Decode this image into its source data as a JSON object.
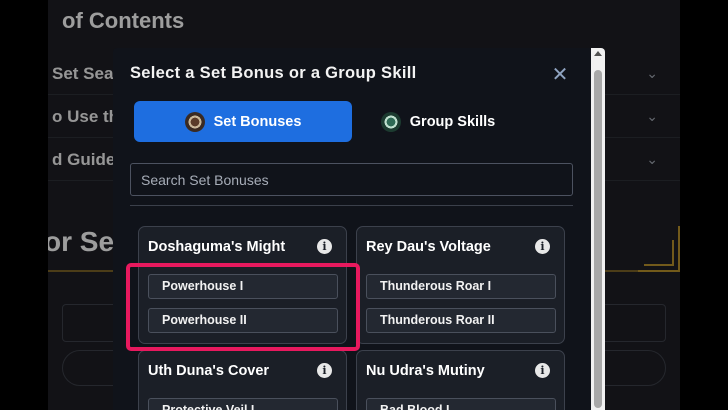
{
  "background": {
    "heading_top": "of Contents",
    "rows": [
      {
        "label": "Set Sea"
      },
      {
        "label": "o Use th"
      },
      {
        "label": "d Guide"
      }
    ],
    "section_title": "or Set"
  },
  "modal": {
    "title": "Select a Set Bonus or a Group Skill",
    "close_icon": "close-icon",
    "tabs": [
      {
        "label": "Set Bonuses",
        "active": true,
        "color": "#1e6ee0"
      },
      {
        "label": "Group Skills",
        "active": false
      }
    ],
    "search": {
      "placeholder": "Search Set Bonuses",
      "value": ""
    },
    "cards": [
      {
        "title": "Doshaguma's Might",
        "skills": [
          "Powerhouse I",
          "Powerhouse II"
        ]
      },
      {
        "title": "Rey Dau's Voltage",
        "skills": [
          "Thunderous Roar I",
          "Thunderous Roar II"
        ]
      },
      {
        "title": "Uth Duna's Cover",
        "skills": [
          "Protective Veil I"
        ]
      },
      {
        "title": "Nu Udra's Mutiny",
        "skills": [
          "Bad Blood I"
        ]
      }
    ]
  },
  "annotation": {
    "color": "#e8195e"
  }
}
